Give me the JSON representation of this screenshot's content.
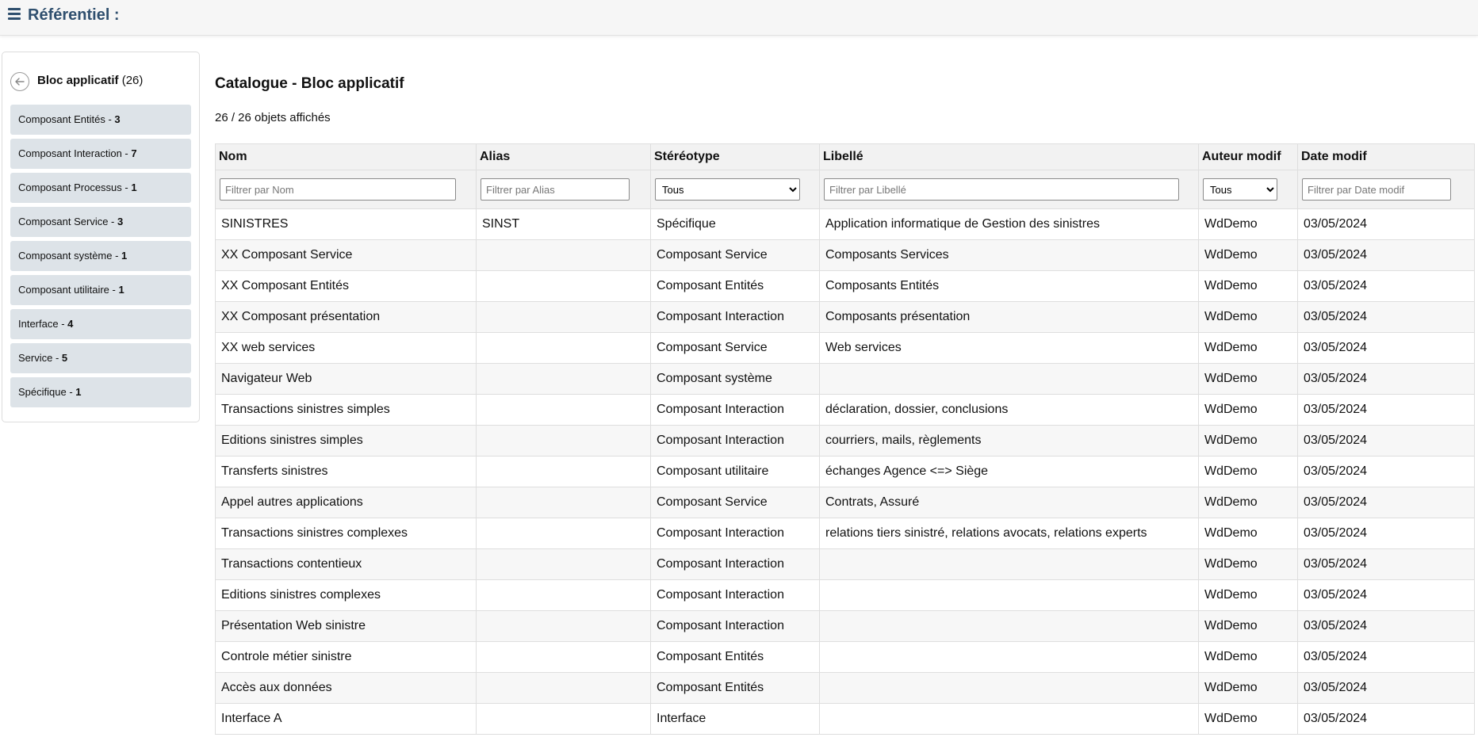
{
  "header": {
    "title": "Référentiel :",
    "menu_icon": "hamburger-menu-icon"
  },
  "sidebar": {
    "back_icon": "back-arrow-circle-icon",
    "title": "Bloc applicatif",
    "title_count": "(26)",
    "items": [
      {
        "label": "Composant Entités - ",
        "count": "3"
      },
      {
        "label": "Composant Interaction - ",
        "count": "7"
      },
      {
        "label": "Composant Processus - ",
        "count": "1"
      },
      {
        "label": "Composant Service - ",
        "count": "3"
      },
      {
        "label": "Composant système - ",
        "count": "1"
      },
      {
        "label": "Composant utilitaire - ",
        "count": "1"
      },
      {
        "label": "Interface - ",
        "count": "4"
      },
      {
        "label": "Service - ",
        "count": "5"
      },
      {
        "label": "Spécifique - ",
        "count": "1"
      }
    ]
  },
  "main": {
    "title": "Catalogue - Bloc applicatif",
    "count_text": "26 / 26 objets affichés",
    "columns": [
      "Nom",
      "Alias",
      "Stéréotype",
      "Libellé",
      "Auteur modif",
      "Date modif"
    ],
    "filters": {
      "nom_placeholder": "Filtrer par Nom",
      "alias_placeholder": "Filtrer par Alias",
      "stereotype_selected": "Tous",
      "libelle_placeholder": "Filtrer par Libellé",
      "auteur_selected": "Tous",
      "date_placeholder": "Filtrer par Date modif"
    },
    "rows": [
      [
        "SINISTRES",
        "SINST",
        "Spécifique",
        "Application informatique de Gestion des sinistres",
        "WdDemo",
        "03/05/2024"
      ],
      [
        "XX Composant Service",
        "",
        "Composant Service",
        "Composants Services",
        "WdDemo",
        "03/05/2024"
      ],
      [
        "XX Composant Entités",
        "",
        "Composant Entités",
        "Composants Entités",
        "WdDemo",
        "03/05/2024"
      ],
      [
        "XX Composant présentation",
        "",
        "Composant Interaction",
        "Composants présentation",
        "WdDemo",
        "03/05/2024"
      ],
      [
        "XX web services",
        "",
        "Composant Service",
        "Web services",
        "WdDemo",
        "03/05/2024"
      ],
      [
        "Navigateur Web",
        "",
        "Composant système",
        "",
        "WdDemo",
        "03/05/2024"
      ],
      [
        "Transactions sinistres simples",
        "",
        "Composant Interaction",
        "déclaration, dossier, conclusions",
        "WdDemo",
        "03/05/2024"
      ],
      [
        "Editions sinistres simples",
        "",
        "Composant Interaction",
        "courriers, mails, règlements",
        "WdDemo",
        "03/05/2024"
      ],
      [
        "Transferts sinistres",
        "",
        "Composant utilitaire",
        "échanges Agence <=> Siège",
        "WdDemo",
        "03/05/2024"
      ],
      [
        "Appel autres applications",
        "",
        "Composant Service",
        "Contrats, Assuré",
        "WdDemo",
        "03/05/2024"
      ],
      [
        "Transactions sinistres complexes",
        "",
        "Composant Interaction",
        "relations tiers sinistré, relations avocats, relations experts",
        "WdDemo",
        "03/05/2024"
      ],
      [
        "Transactions contentieux",
        "",
        "Composant Interaction",
        "",
        "WdDemo",
        "03/05/2024"
      ],
      [
        "Editions sinistres complexes",
        "",
        "Composant Interaction",
        "",
        "WdDemo",
        "03/05/2024"
      ],
      [
        "Présentation Web sinistre",
        "",
        "Composant Interaction",
        "",
        "WdDemo",
        "03/05/2024"
      ],
      [
        "Controle métier sinistre",
        "",
        "Composant Entités",
        "",
        "WdDemo",
        "03/05/2024"
      ],
      [
        "Accès aux données",
        "",
        "Composant Entités",
        "",
        "WdDemo",
        "03/05/2024"
      ],
      [
        "Interface A",
        "",
        "Interface",
        "",
        "WdDemo",
        "03/05/2024"
      ]
    ]
  }
}
